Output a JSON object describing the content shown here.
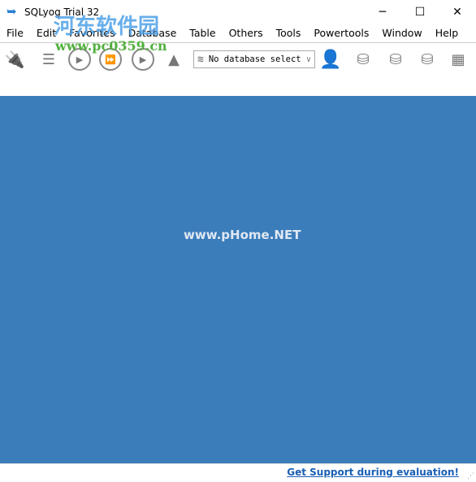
{
  "window": {
    "title": "SQLyog Trial 32",
    "minimize": "─",
    "maximize": "☐",
    "close": "✕"
  },
  "menu": [
    "File",
    "Edit",
    "Favorites",
    "Database",
    "Table",
    "Others",
    "Tools",
    "Powertools",
    "Window",
    "Help"
  ],
  "toolbar": {
    "db_select": "No database select"
  },
  "watermarks": {
    "cn": "河东软件园",
    "url1": "www.pc0359.cn",
    "url2": "www.pHome.NET"
  },
  "status": {
    "support_link": "Get Support during evaluation!"
  }
}
